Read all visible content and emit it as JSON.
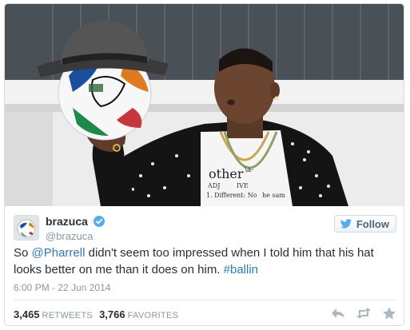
{
  "tweet": {
    "display_name": "brazuca",
    "handle": "@brazuca",
    "text_before": "So ",
    "mention": "@Pharrell",
    "text_middle": " didn't seem too impressed when I told him that his hat looks better on me than it does on him. ",
    "hashtag": "#ballin",
    "timestamp": "6:00 PM - 22 Jun 2014",
    "retweets_count": "3,465",
    "retweets_label": "RETWEETS",
    "favorites_count": "3,766",
    "favorites_label": "FAVORITES"
  },
  "follow_button": {
    "label": "Follow"
  },
  "photo": {
    "shirt_text_1": "other",
    "shirt_text_2": "\\a-",
    "shirt_text_3": "ADJ",
    "shirt_text_4": "IVE",
    "shirt_text_5": "1. Different: No",
    "shirt_text_6": "he sam"
  },
  "icons": {
    "verified": "verified-badge-icon",
    "twitter_bird": "twitter-bird-icon",
    "reply": "reply-icon",
    "retweet": "retweet-icon",
    "favorite": "star-icon"
  },
  "colors": {
    "link": "#2b7bb9",
    "verified": "#55acee",
    "muted": "#8899a6"
  }
}
